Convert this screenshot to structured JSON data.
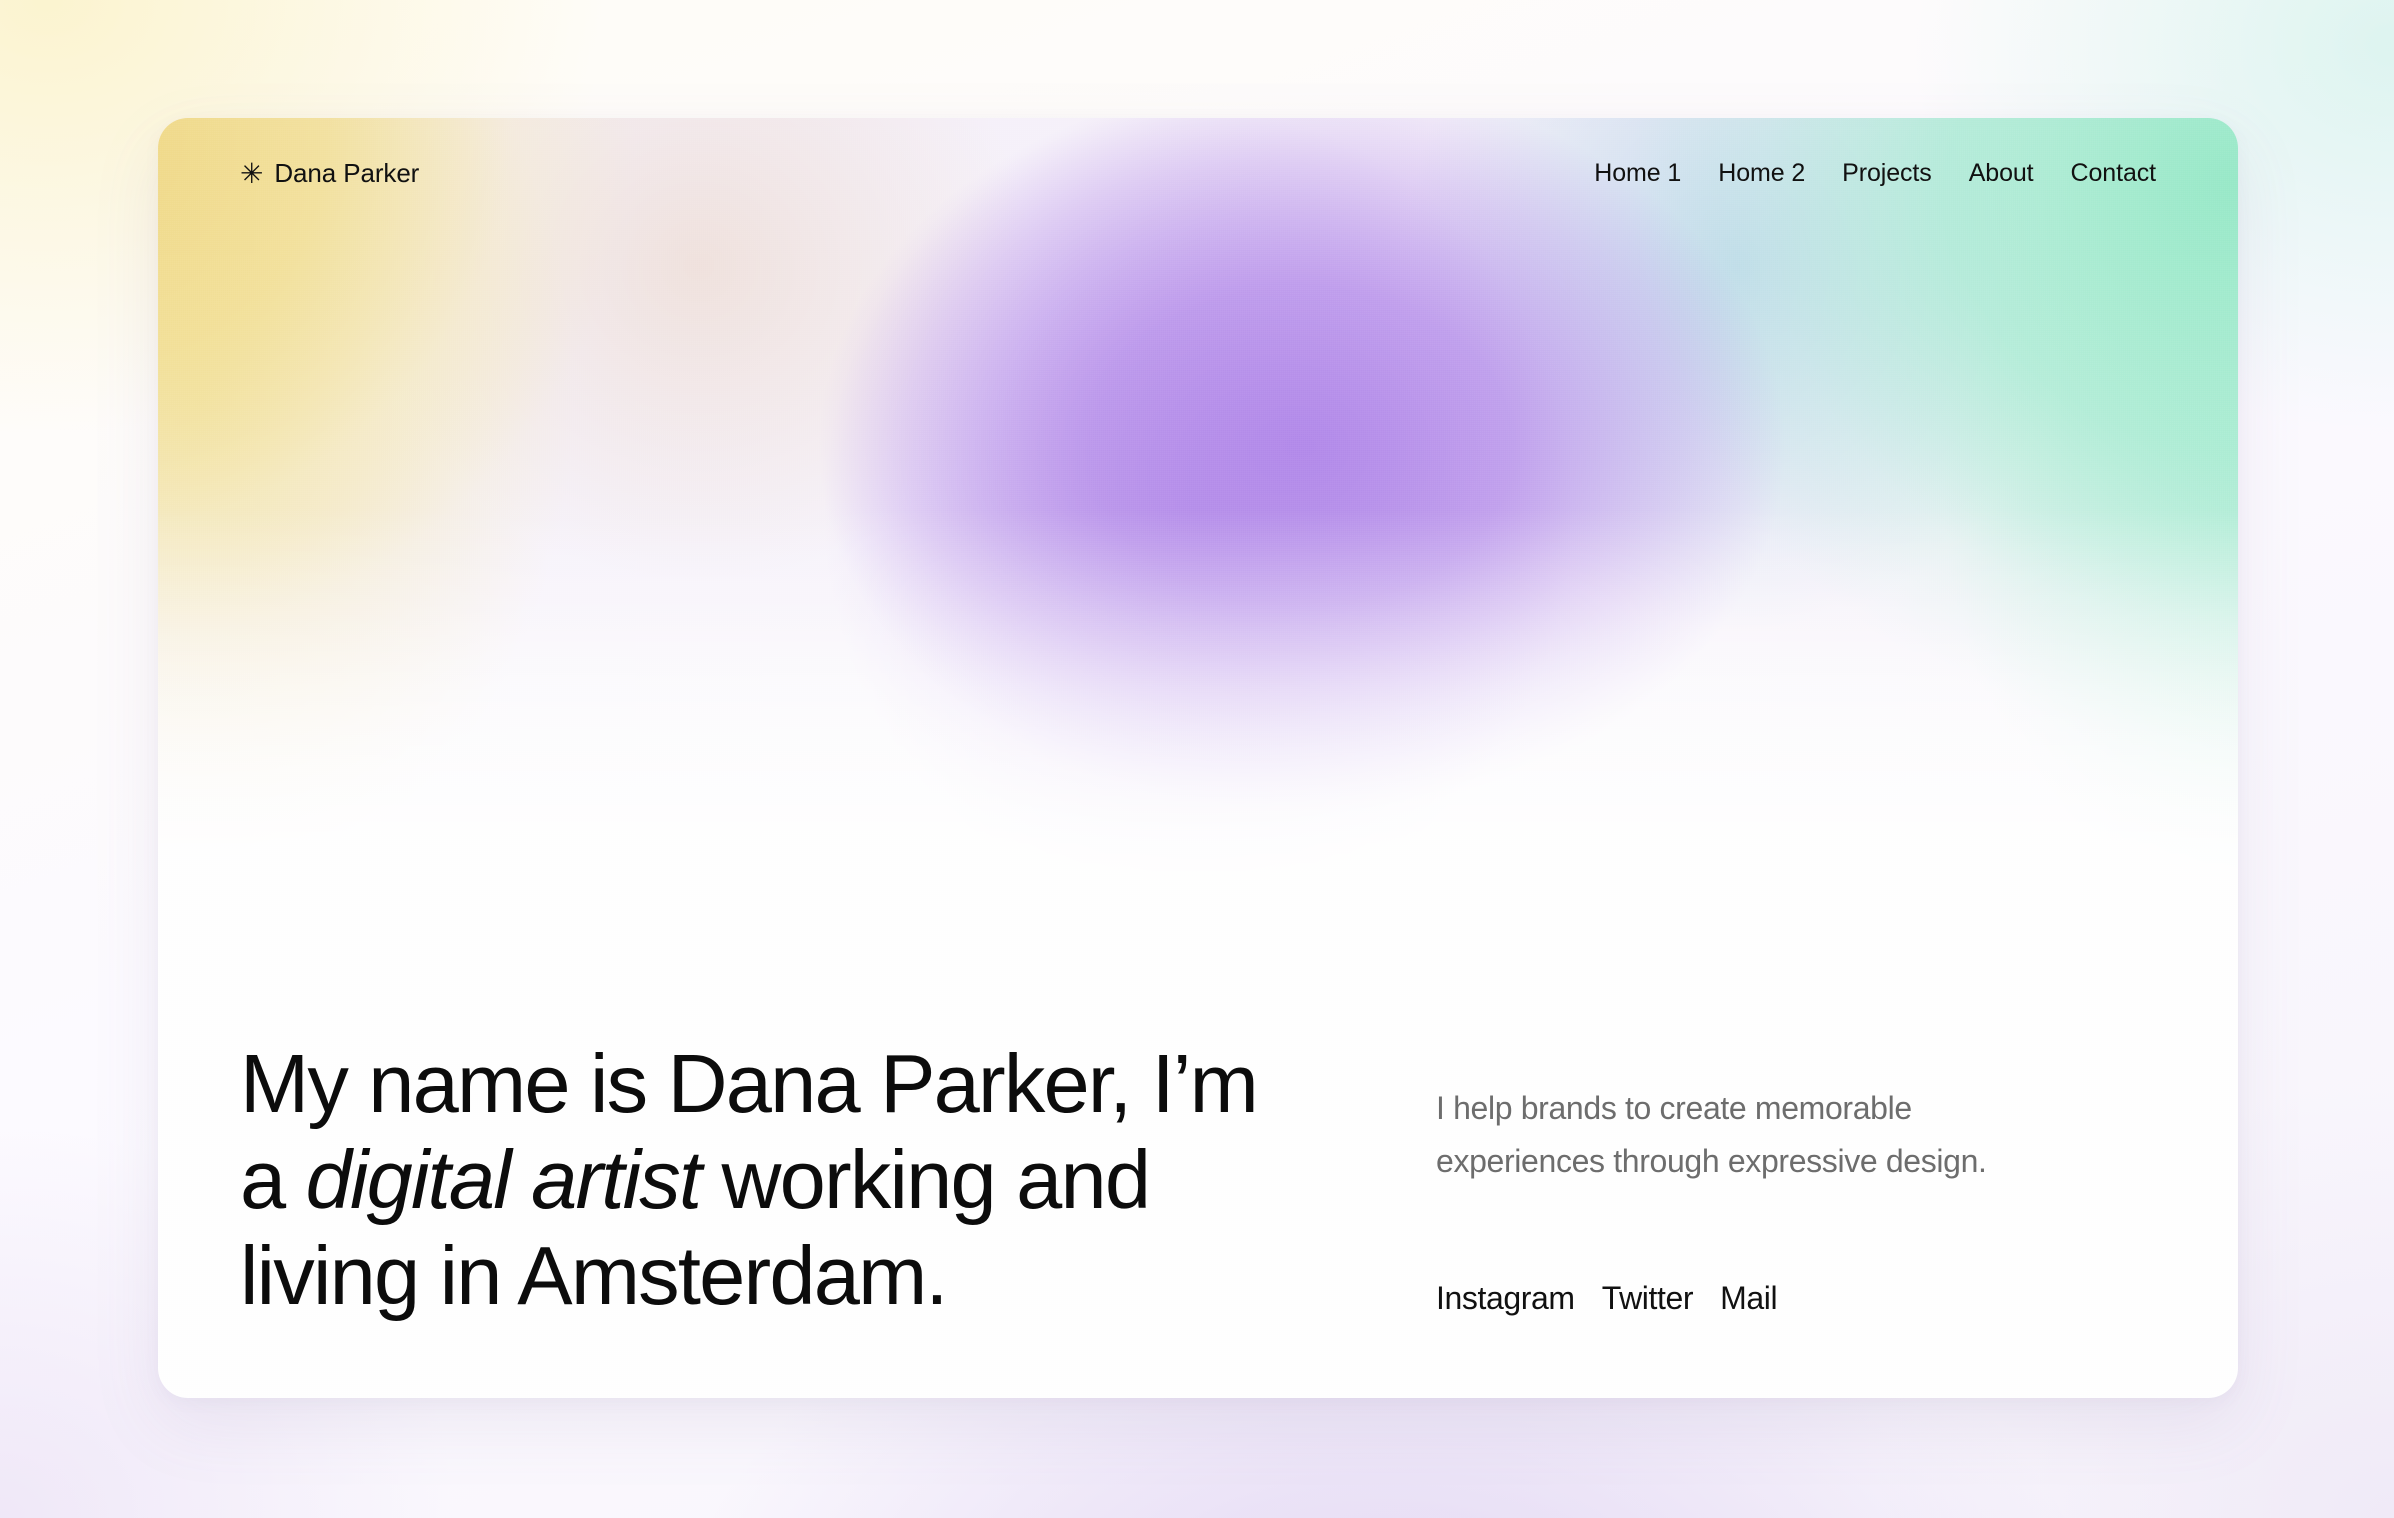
{
  "brand": {
    "icon": "asterisk-icon",
    "glyph": "✳",
    "name": "Dana Parker"
  },
  "nav": {
    "items": [
      {
        "label": "Home 1"
      },
      {
        "label": "Home 2"
      },
      {
        "label": "Projects"
      },
      {
        "label": "About"
      },
      {
        "label": "Contact"
      }
    ]
  },
  "hero": {
    "headline": {
      "part1": "My name is Dana Parker, I’m a ",
      "emphasis": "digital artist",
      "part2": " working and living in Amsterdam.",
      "full": "My name is Dana Parker, I’m a digital artist working and living in Amsterdam."
    },
    "tagline": "I help brands to create memorable experiences through expressive design.",
    "social": [
      {
        "label": "Instagram"
      },
      {
        "label": "Twitter"
      },
      {
        "label": "Mail"
      }
    ]
  },
  "colors": {
    "gradient_yellow": "#F0D780",
    "gradient_purple": "#B086E9",
    "gradient_blue": "#B7D4E9",
    "gradient_mint": "#96E9C7",
    "card_background": "#FFFFFF",
    "page_background": "#FDFCFB",
    "text_primary": "#0C0C0C",
    "text_muted": "#6D6D6D"
  }
}
